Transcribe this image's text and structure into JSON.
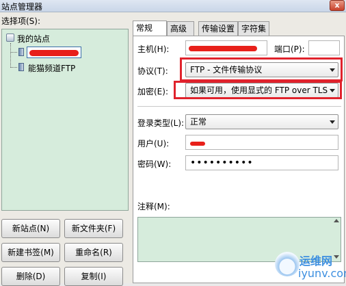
{
  "window": {
    "title": "站点管理器",
    "close_glyph": "x"
  },
  "tree": {
    "label": "选择项(S):",
    "root": "我的站点",
    "items": [
      {
        "label": "",
        "redacted": true
      },
      {
        "label": "能猫频道FTP"
      }
    ]
  },
  "buttons": {
    "new_site": "新站点(N)",
    "new_folder": "新文件夹(F)",
    "new_bookmark": "新建书签(M)",
    "rename": "重命名(R)",
    "delete": "删除(D)",
    "copy": "复制(I)"
  },
  "tabs": [
    "常规",
    "高级",
    "传输设置",
    "字符集"
  ],
  "form": {
    "host_label": "主机(H):",
    "port_label": "端口(P):",
    "protocol_label": "协议(T):",
    "protocol_value": "FTP - 文件传输协议",
    "encryption_label": "加密(E):",
    "encryption_value": "如果可用，使用显式的 FTP over TLS",
    "login_label": "登录类型(L):",
    "login_value": "正常",
    "user_label": "用户(U):",
    "password_label": "密码(W):",
    "password_value": "••••••••••",
    "notes_label": "注释(M):"
  },
  "watermark": {
    "line1": "运维网",
    "line2": "iyunv.com"
  },
  "colors": {
    "highlight": "#e0222c",
    "tree_bg": "#d6ecdc",
    "watermark": "#3d8fe0"
  }
}
